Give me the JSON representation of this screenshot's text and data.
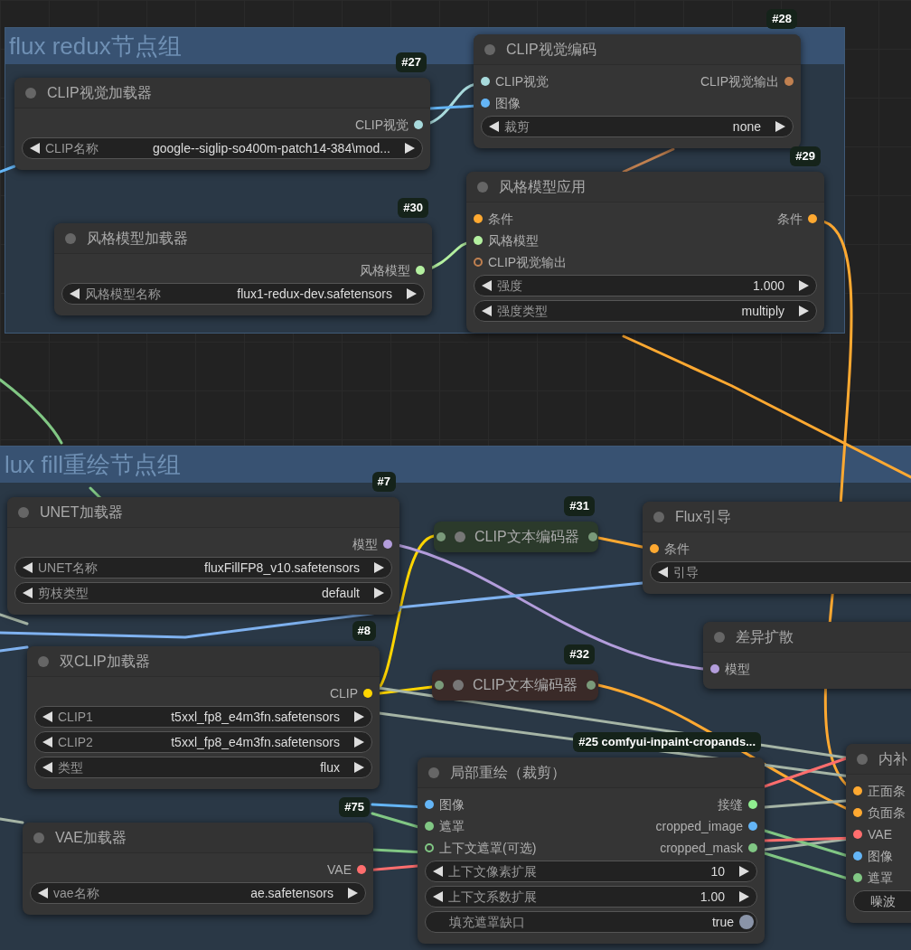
{
  "groups": [
    {
      "title": "flux redux节点组"
    },
    {
      "title": "lux fill重绘节点组"
    }
  ],
  "nodes": [
    {
      "kind": "full",
      "badge": "#27",
      "title": "CLIP视觉加载器",
      "outputs": [
        {
          "label": "CLIP视觉",
          "color": "#a8dadc"
        }
      ],
      "widgets": [
        {
          "kind": "combo",
          "label": "CLIP名称",
          "value": "google--siglip-so400m-patch14-384\\mod..."
        }
      ]
    },
    {
      "kind": "full",
      "badge": "#28",
      "title": "CLIP视觉编码",
      "inputs": [
        {
          "label": "CLIP视觉",
          "color": "#a8dadc",
          "optional": false
        },
        {
          "label": "图像",
          "color": "#64b5f6",
          "optional": false
        }
      ],
      "outputs": [
        {
          "label": "CLIP视觉输出",
          "color": "#c08050"
        }
      ],
      "widgets": [
        {
          "kind": "combo",
          "label": "裁剪",
          "value": "none"
        }
      ]
    },
    {
      "kind": "full",
      "badge": "#30",
      "title": "风格模型加载器",
      "outputs": [
        {
          "label": "风格模型",
          "color": "#b4f0a0"
        }
      ],
      "widgets": [
        {
          "kind": "combo",
          "label": "风格模型名称",
          "value": "flux1-redux-dev.safetensors"
        }
      ]
    },
    {
      "kind": "full",
      "badge": "#29",
      "title": "风格模型应用",
      "inputs": [
        {
          "label": "条件",
          "color": "#ffa931",
          "optional": false
        },
        {
          "label": "风格模型",
          "color": "#b4f0a0",
          "optional": false
        },
        {
          "label": "CLIP视觉输出",
          "color": "#c08050",
          "optional": true
        }
      ],
      "outputs": [
        {
          "label": "条件",
          "color": "#ffa931"
        }
      ],
      "widgets": [
        {
          "kind": "number",
          "label": "强度",
          "value": "1.000"
        },
        {
          "kind": "combo",
          "label": "强度类型",
          "value": "multiply"
        }
      ]
    },
    {
      "kind": "full",
      "badge": "#7",
      "title": "UNET加载器",
      "outputs": [
        {
          "label": "模型",
          "color": "#b39ddb"
        }
      ],
      "widgets": [
        {
          "kind": "combo",
          "label": "UNET名称",
          "value": "fluxFillFP8_v10.safetensors"
        },
        {
          "kind": "combo",
          "label": "剪枝类型",
          "value": "default"
        }
      ]
    },
    {
      "kind": "collapsed",
      "badge": "#31",
      "title": "CLIP文本编码器",
      "color": "#2b3a2b"
    },
    {
      "kind": "full",
      "title": "Flux引导",
      "inputs": [
        {
          "label": "条件",
          "color": "#ffa931",
          "optional": false
        }
      ],
      "widgets": [
        {
          "kind": "number",
          "label": "引导"
        }
      ]
    },
    {
      "kind": "full",
      "badge": "#8",
      "title": "双CLIP加载器",
      "outputs": [
        {
          "label": "CLIP",
          "color": "#ffd500"
        }
      ],
      "widgets": [
        {
          "kind": "combo",
          "label": "CLIP1",
          "value": "t5xxl_fp8_e4m3fn.safetensors"
        },
        {
          "kind": "combo",
          "label": "CLIP2",
          "value": "t5xxl_fp8_e4m3fn.safetensors"
        },
        {
          "kind": "combo",
          "label": "类型",
          "value": "flux"
        }
      ]
    },
    {
      "kind": "collapsed",
      "badge": "#32",
      "title": "CLIP文本编码器",
      "color": "#3a2a28"
    },
    {
      "kind": "full",
      "title": "差异扩散",
      "inputs": [
        {
          "label": "模型",
          "color": "#b39ddb",
          "optional": false
        }
      ]
    },
    {
      "kind": "full",
      "badge": "#75",
      "title": "VAE加载器",
      "outputs": [
        {
          "label": "VAE",
          "color": "#ff6e6e"
        }
      ],
      "widgets": [
        {
          "kind": "combo",
          "label": "vae名称",
          "value": "ae.safetensors"
        }
      ]
    },
    {
      "kind": "full",
      "badge": "#25 comfyui-inpaint-cropands...",
      "title": "局部重绘（裁剪）",
      "inputs": [
        {
          "label": "图像",
          "color": "#64b5f6",
          "optional": false
        },
        {
          "label": "遮罩",
          "color": "#81c784",
          "optional": false
        },
        {
          "label": "上下文遮罩(可选)",
          "color": "#81c784",
          "optional": true
        }
      ],
      "outputs": [
        {
          "label": "接缝",
          "color": "#90ee90"
        },
        {
          "label": "cropped_image",
          "color": "#64b5f6"
        },
        {
          "label": "cropped_mask",
          "color": "#81c784"
        }
      ],
      "widgets": [
        {
          "kind": "number",
          "label": "上下文像素扩展",
          "value": "10"
        },
        {
          "kind": "number",
          "label": "上下文系数扩展",
          "value": "1.00"
        },
        {
          "kind": "toggle",
          "label": "填充遮罩缺口",
          "value": "true",
          "on": true
        }
      ]
    },
    {
      "kind": "full",
      "title": "内补",
      "inputs": [
        {
          "label": "正面条",
          "color": "#ffa931",
          "optional": false
        },
        {
          "label": "负面条",
          "color": "#ffa931",
          "optional": false
        },
        {
          "label": "VAE",
          "color": "#ff6e6e",
          "optional": false
        },
        {
          "label": "图像",
          "color": "#64b5f6",
          "optional": false
        },
        {
          "label": "遮罩",
          "color": "#81c784",
          "optional": false
        }
      ],
      "widgets": [
        {
          "kind": "button",
          "label": "噪波"
        }
      ]
    }
  ]
}
